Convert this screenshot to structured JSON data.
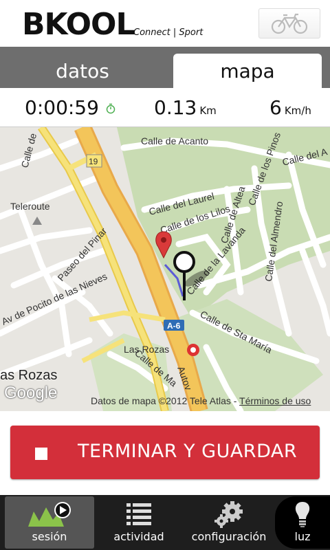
{
  "header": {
    "brand": "BKOOL",
    "tagline": "Connect | Sport",
    "bike_icon": "bicycle-icon"
  },
  "tabs": [
    {
      "label": "datos",
      "active": false
    },
    {
      "label": "mapa",
      "active": true
    }
  ],
  "stats": {
    "time": "0:00:59",
    "distance": "0.13",
    "distance_unit": "Km",
    "speed": "6",
    "speed_unit": "Km/h"
  },
  "map": {
    "streets": [
      "Calle de Acanto",
      "Calle del A",
      "Calle de",
      "Calle del Laurel",
      "Calle de los Lilos",
      "Calle de Altea",
      "Calle de los Pinos",
      "Calle del Almendro",
      "Calle de la Lavanda",
      "Paseo del Pinar",
      "Av de Pocito de las Nieves",
      "Calle de Sta María",
      "Calle de Ma",
      "Autov",
      "Teleroute",
      "Las Rozas",
      "A-6",
      "19"
    ],
    "city_label": "as Rozas",
    "google_logo": "Google",
    "credits": "Datos de mapa ©2012 Tele Atlas - ",
    "terms": "Términos de uso"
  },
  "action_button": {
    "label": "TERMINAR Y GUARDAR"
  },
  "bottom_nav": [
    {
      "label": "sesión",
      "icon": "session-icon",
      "active": true
    },
    {
      "label": "actividad",
      "icon": "list-icon",
      "active": false
    },
    {
      "label": "configuración",
      "icon": "gears-icon",
      "active": false
    },
    {
      "label": "luz",
      "icon": "light-bulb-icon",
      "active": false
    }
  ],
  "colors": {
    "accent": "#d32f3a",
    "tab_bar": "#6e6e6e",
    "nav_bg": "#1e1e1e",
    "timer": "#4caf50"
  }
}
